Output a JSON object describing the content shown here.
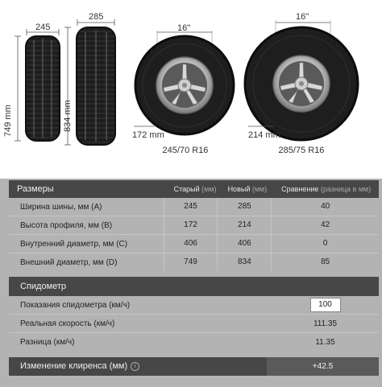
{
  "diagram": {
    "old_width_label": "245",
    "new_width_label": "285",
    "old_diameter_label": "749 mm",
    "new_diameter_label": "834 mm",
    "rim_label_1": "16\"",
    "rim_label_2": "16\"",
    "old_sidewall_label": "172 mm",
    "new_sidewall_label": "214 mm",
    "old_size": "245/70 R16",
    "new_size": "285/75 R16"
  },
  "sizes": {
    "title": "Размеры",
    "col_old": "Старый",
    "col_new": "Новый",
    "col_cmp": "Сравнение",
    "unit_mm": "(мм)",
    "unit_cmp": "(разница в мм)",
    "rows": [
      {
        "label": "Ширина шины, мм (A)",
        "old": "245",
        "new": "285",
        "diff": "40"
      },
      {
        "label": "Высота профиля, мм (B)",
        "old": "172",
        "new": "214",
        "diff": "42"
      },
      {
        "label": "Внутренний диаметр, мм (C)",
        "old": "406",
        "new": "406",
        "diff": "0"
      },
      {
        "label": "Внешний диаметр, мм (D)",
        "old": "749",
        "new": "834",
        "diff": "85"
      }
    ]
  },
  "speedometer": {
    "title": "Спидометр",
    "reading_label": "Показания спидометра (км/ч)",
    "reading_value": "100",
    "real_label": "Реальная скорость (км/ч)",
    "real_value": "111.35",
    "diff_label": "Разница (км/ч)",
    "diff_value": "11.35"
  },
  "clearance": {
    "label": "Изменение клиренса (мм)",
    "value": "+42.5"
  }
}
